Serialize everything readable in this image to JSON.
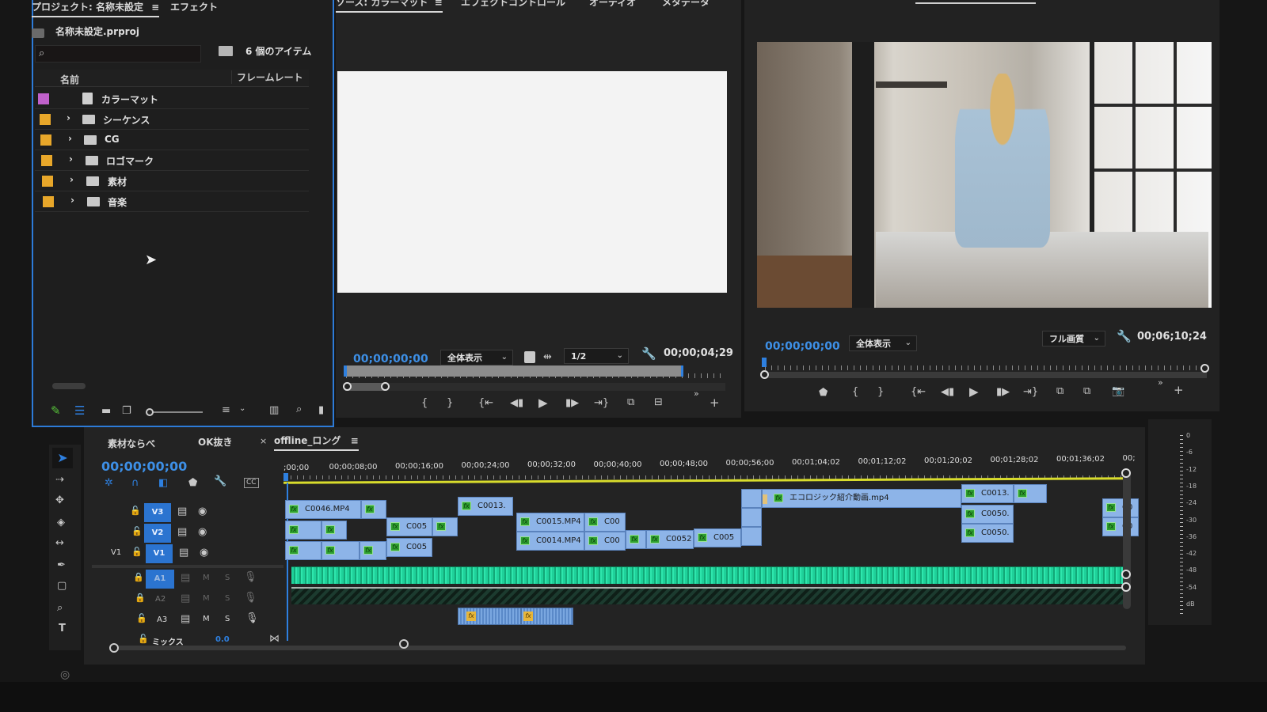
{
  "project_panel": {
    "tabs": [
      {
        "label": "プロジェクト: 名称未設定",
        "active": true
      },
      {
        "label": "エフェクト",
        "active": false
      }
    ],
    "file_name": "名称未設定.prproj",
    "search_placeholder": "",
    "item_count": "6 個のアイテム",
    "columns": {
      "name": "名前",
      "framerate": "フレームレート"
    },
    "items": [
      {
        "label": "カラーマット",
        "color": "#c061cb",
        "type": "file",
        "expandable": false
      },
      {
        "label": "シーケンス",
        "color": "#e8a72a",
        "type": "folder",
        "expandable": true
      },
      {
        "label": "CG",
        "color": "#e8a72a",
        "type": "folder",
        "expandable": true
      },
      {
        "label": "ロゴマーク",
        "color": "#e8a72a",
        "type": "folder",
        "expandable": true
      },
      {
        "label": "素材",
        "color": "#e8a72a",
        "type": "folder",
        "expandable": true
      },
      {
        "label": "音楽",
        "color": "#e8a72a",
        "type": "folder",
        "expandable": true
      }
    ]
  },
  "source_monitor": {
    "tabs": [
      {
        "label": "ソース: カラーマット",
        "active": true
      },
      {
        "label": "エフェクトコントロール",
        "active": false
      },
      {
        "label": "オーディオ",
        "active": false
      },
      {
        "label": "メタデータ",
        "active": false
      }
    ],
    "timecode_current": "00;00;00;00",
    "zoom_select": "全体表示",
    "resolution_select": "1/2",
    "timecode_duration": "00;00;04;29"
  },
  "program_monitor": {
    "timecode_current": "00;00;00;00",
    "zoom_select": "全体表示",
    "quality_select": "フル画質",
    "timecode_duration": "00;06;10;24"
  },
  "timeline": {
    "tabs": [
      {
        "label": "素材ならべ",
        "active": false,
        "closable": false
      },
      {
        "label": "OK抜き",
        "active": false,
        "closable": false
      },
      {
        "label": "offline_ロング",
        "active": true,
        "closable": true
      }
    ],
    "timecode": "00;00;00;00",
    "ruler_labels": [
      ";00;00",
      "00;00;08;00",
      "00;00;16;00",
      "00;00;24;00",
      "00;00;32;00",
      "00;00;40;00",
      "00;00;48;00",
      "00;00;56;00",
      "00;01;04;02",
      "00;01;12;02",
      "00;01;20;02",
      "00;01;28;02",
      "00;01;36;02",
      "00;"
    ],
    "video_tracks": [
      {
        "label": "V3",
        "source": ""
      },
      {
        "label": "V2",
        "source": ""
      },
      {
        "label": "V1",
        "source": "V1"
      }
    ],
    "audio_tracks": [
      {
        "label": "A1",
        "m": "M",
        "s": "S"
      },
      {
        "label": "A2",
        "m": "M",
        "s": "S"
      },
      {
        "label": "A3",
        "m": "M",
        "s": "S"
      }
    ],
    "mix_label": "ミックス",
    "mix_value": "0.0",
    "clips_v3": [
      {
        "label": "C0046.MP4"
      },
      {
        "label": ""
      },
      {
        "label": "C0013."
      },
      {
        "label": "エコロジック紹介動画.mp4"
      },
      {
        "label": "C0013."
      },
      {
        "label": ""
      },
      {
        "label": "C0"
      }
    ],
    "clips_v2": [
      {
        "label": ""
      },
      {
        "label": ""
      },
      {
        "label": "C005"
      },
      {
        "label": ""
      },
      {
        "label": "C0015.MP4"
      },
      {
        "label": "C00"
      },
      {
        "label": "C0050."
      },
      {
        "label": "C0"
      }
    ],
    "clips_v1": [
      {
        "label": ""
      },
      {
        "label": ""
      },
      {
        "label": ""
      },
      {
        "label": "C005"
      },
      {
        "label": "C0014.MP4"
      },
      {
        "label": "C00"
      },
      {
        "label": ""
      },
      {
        "label": "C0052"
      },
      {
        "label": "C005"
      },
      {
        "label": "C0050."
      }
    ]
  },
  "audio_meter": {
    "labels": [
      "0",
      "-6",
      "-12",
      "-18",
      "-24",
      "-30",
      "-36",
      "-42",
      "-48",
      "-54",
      "dB"
    ]
  },
  "icons": {
    "fx": "fx"
  }
}
